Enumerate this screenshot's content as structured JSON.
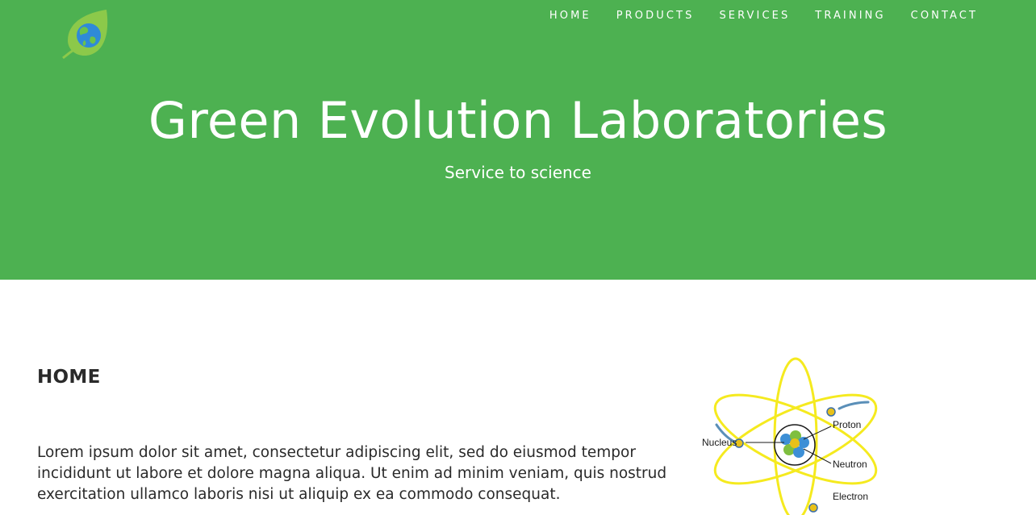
{
  "nav": {
    "items": [
      {
        "label": "HOME"
      },
      {
        "label": "PRODUCTS"
      },
      {
        "label": "SERVICES"
      },
      {
        "label": "TRAINING"
      },
      {
        "label": "CONTACT"
      }
    ]
  },
  "hero": {
    "title": "Green Evolution Laboratories",
    "subtitle": "Service to science"
  },
  "main": {
    "heading": "HOME",
    "paragraph": "Lorem ipsum dolor sit amet, consectetur adipiscing elit, sed do eiusmod tempor incididunt ut labore et dolore magna aliqua. Ut enim ad minim veniam, quis nostrud exercitation ullamco laboris nisi ut aliquip ex ea commodo consequat."
  },
  "atom_diagram": {
    "labels": {
      "nucleus": "Nucleus",
      "proton": "Proton",
      "neutron": "Neutron",
      "electron": "Electron"
    }
  },
  "colors": {
    "brand_green": "#4db151",
    "text_dark": "#2a2a2a",
    "orbit_yellow": "#f5ea1f"
  },
  "icons": {
    "logo": "leaf-globe-icon"
  }
}
